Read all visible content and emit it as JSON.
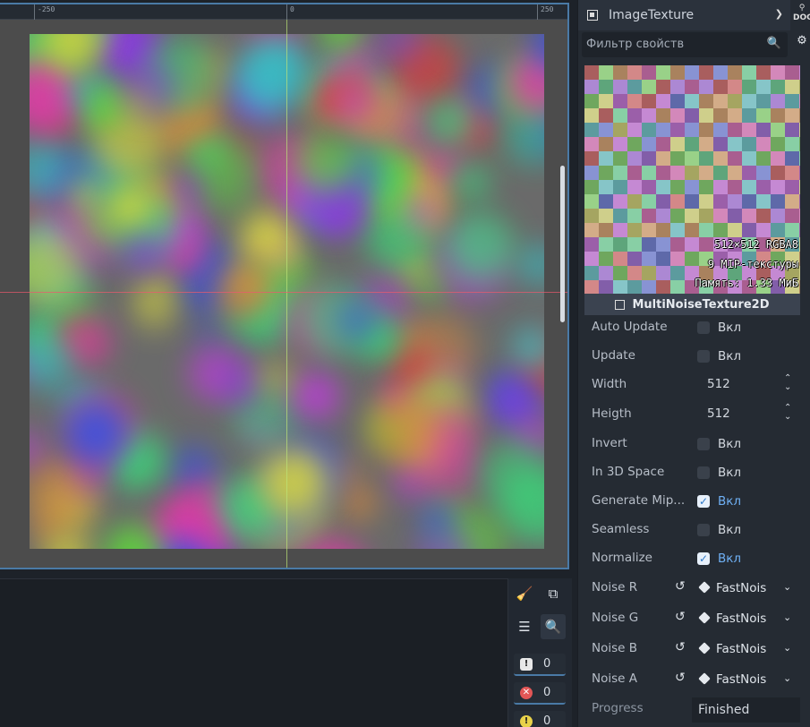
{
  "viewport": {
    "ruler_ticks": [
      "-250",
      "0",
      "250"
    ],
    "noise_colors": [
      "#c23be0",
      "#35c2c8",
      "#5fdc3a",
      "#e03a3a",
      "#3a52e0",
      "#d6d640",
      "#e03aa8",
      "#3ad87a",
      "#8a3ae0",
      "#e08a3a"
    ]
  },
  "inspector": {
    "resource_type": "ImageTexture",
    "doc_label": "DOC",
    "filter_placeholder": "Фильтр свойств",
    "preview": {
      "line1": "512×512 RGBA8",
      "line2": "9 MIP-текстуры",
      "line3": "Память: 1.33 МиБ"
    },
    "class_name": "MultiNoiseTexture2D",
    "properties": [
      {
        "label": "Auto Update",
        "kind": "bool",
        "checked": false,
        "text": "Вкл"
      },
      {
        "label": "Update",
        "kind": "bool",
        "checked": false,
        "text": "Вкл"
      },
      {
        "label": "Width",
        "kind": "number",
        "value": "512"
      },
      {
        "label": "Heigth",
        "kind": "number",
        "value": "512"
      },
      {
        "label": "Invert",
        "kind": "bool",
        "checked": false,
        "text": "Вкл"
      },
      {
        "label": "In 3D Space",
        "kind": "bool",
        "checked": false,
        "text": "Вкл"
      },
      {
        "label": "Generate Mip...",
        "kind": "bool",
        "checked": true,
        "text": "Вкл"
      },
      {
        "label": "Seamless",
        "kind": "bool",
        "checked": false,
        "text": "Вкл"
      },
      {
        "label": "Normalize",
        "kind": "bool",
        "checked": true,
        "text": "Вкл"
      },
      {
        "label": "Noise R",
        "kind": "resource",
        "value": "FastNois"
      },
      {
        "label": "Noise G",
        "kind": "resource",
        "value": "FastNois"
      },
      {
        "label": "Noise B",
        "kind": "resource",
        "value": "FastNois"
      },
      {
        "label": "Noise A",
        "kind": "resource",
        "value": "FastNois"
      }
    ],
    "progress_label": "Progress",
    "progress_value": "Finished"
  },
  "bottom_panel": {
    "counts": [
      {
        "icon": "message-icon",
        "value": "0",
        "color": "#e8e8e8"
      },
      {
        "icon": "error-icon",
        "value": "0",
        "color": "#e25656"
      },
      {
        "icon": "warning-icon",
        "value": "0",
        "color": "#e8d24a"
      }
    ]
  }
}
